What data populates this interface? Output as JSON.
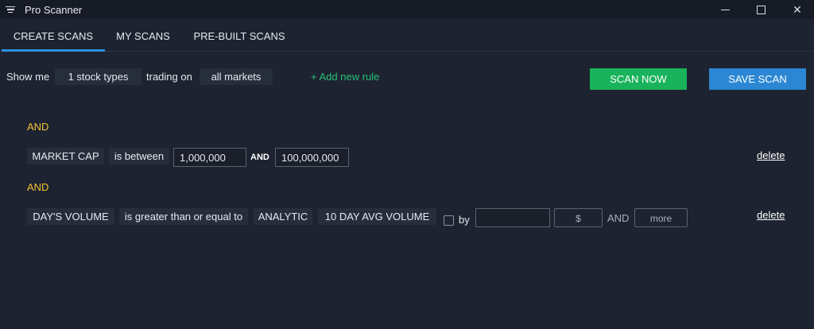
{
  "window": {
    "title": "Pro Scanner",
    "menu_icon": "menu-icon",
    "minimize_icon": "minimize-icon",
    "maximize_icon": "maximize-icon",
    "close_icon": "close-icon"
  },
  "tabs": [
    {
      "label": "CREATE SCANS",
      "active": true
    },
    {
      "label": "MY SCANS",
      "active": false
    },
    {
      "label": "PRE-BUILT SCANS",
      "active": false
    }
  ],
  "top_row": {
    "show_me": "Show me",
    "stock_types": "1 stock types",
    "trading_on": "trading on",
    "markets": "all markets",
    "add_rule": "+ Add new rule",
    "scan_now": "SCAN NOW",
    "save_scan": "SAVE SCAN"
  },
  "rules": [
    {
      "connector": "AND",
      "field": "MARKET CAP",
      "operator": "is between",
      "value_from": "1,000,000",
      "and_label": "AND",
      "value_to": "100,000,000",
      "delete_label": "delete"
    },
    {
      "connector": "AND",
      "field": "DAY'S VOLUME",
      "operator": "is greater than or equal to",
      "compare_type": "ANALYTIC",
      "compare_field": "10 DAY AVG VOLUME",
      "by_label": "by",
      "by_value": "",
      "unit_button": "$",
      "and_label": "AND",
      "more_button": "more",
      "delete_label": "delete"
    }
  ],
  "colors": {
    "background": "#1d2330",
    "accent_green": "#19b35b",
    "accent_blue": "#2b87d3",
    "connector_yellow": "#f1c232",
    "tab_underline": "#2d8fe0"
  }
}
